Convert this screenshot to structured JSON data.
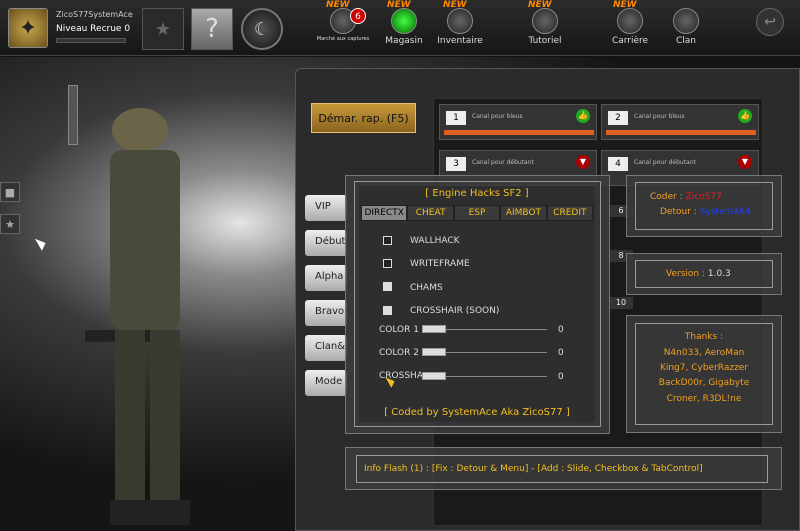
{
  "topbar": {
    "player_name": "ZicoS77SystemAce",
    "player_rank": "Niveau Recrue 0",
    "buttons": [
      {
        "label": "Marché aux captures",
        "badge": "6",
        "new": "NEW"
      },
      {
        "label": "Magasin",
        "new": "NEW"
      },
      {
        "label": "Inventaire",
        "new": "NEW"
      },
      {
        "label": "Tutoriel",
        "new": "NEW"
      },
      {
        "label": "Carrière",
        "new": "NEW"
      },
      {
        "label": "Clan"
      }
    ]
  },
  "lobby": {
    "quick_start": "Démar. rap. (F5)",
    "modes": [
      "VIP",
      "Débuta",
      "Alpha",
      "Bravo",
      "Clan&",
      "Mode"
    ],
    "channels": [
      {
        "num": "1",
        "name": "Canal pour bleus",
        "status": "green"
      },
      {
        "num": "2",
        "name": "Canal pour bleus",
        "status": "green"
      },
      {
        "num": "3",
        "name": "Canal pour débutant",
        "status": "red"
      },
      {
        "num": "4",
        "name": "Canal pour débutant",
        "status": "red"
      }
    ],
    "channel_numbers_partial": [
      "6",
      "8",
      "10"
    ]
  },
  "hack_menu": {
    "title": "[ Engine Hacks SF2 ]",
    "tabs": [
      "DIRECTX",
      "CHEAT",
      "ESP",
      "AIMBOT",
      "CREDIT"
    ],
    "active_tab": 0,
    "checkboxes": [
      {
        "label": "WALLHACK",
        "checked": false
      },
      {
        "label": "WRITEFRAME",
        "checked": false
      },
      {
        "label": "CHAMS",
        "checked": true
      },
      {
        "label": "CROSSHAIR (SOON)",
        "checked": true
      }
    ],
    "sliders": [
      {
        "label": "COLOR 1",
        "value": "0"
      },
      {
        "label": "COLOR 2",
        "value": "0"
      },
      {
        "label": "CROSSHA",
        "value": "0"
      }
    ],
    "footer": "[ Coded by SystemAce Aka ZicoS77 ]"
  },
  "info_panel": {
    "coder_label": "Coder :",
    "coder_value": "ZicoS77",
    "detour_label": "Detour :",
    "detour_value": "SystemX64",
    "version_label": "Version :",
    "version_value": "1.0.3",
    "thanks_title": "Thanks :",
    "thanks_lines": [
      "N4n033, AeroMan",
      "King7, CyberRazzer",
      "BackD00r, Gigabyte",
      "Croner, R3DL!ne"
    ]
  },
  "info_flash": {
    "prefix": "Info Flash (1) :",
    "fix": "[Fix : Detour & Menu]",
    "sep": "-",
    "add": "[Add : Slide, Checkbox & TabControl]"
  },
  "icons": {
    "rank": "eagle-emblem-icon",
    "back": "back-arrow-icon",
    "side1": "square-icon",
    "side2": "star-icon"
  }
}
